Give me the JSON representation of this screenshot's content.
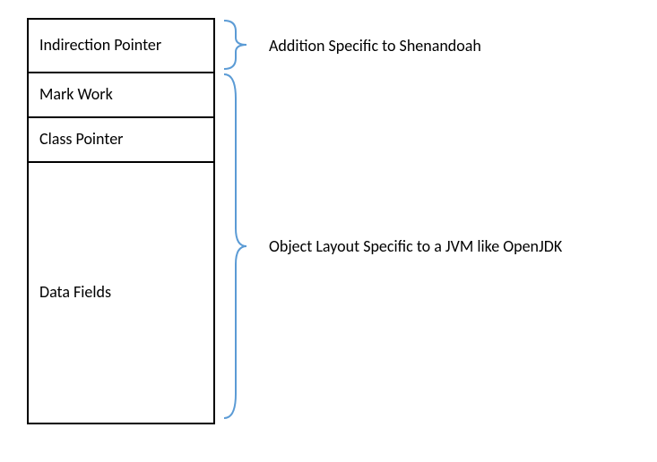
{
  "cells": {
    "indirection": "Indirection Pointer",
    "mark": "Mark Work",
    "classp": "Class Pointer",
    "data": "Data Fields"
  },
  "labels": {
    "top": "Addition Specific to Shenandoah",
    "bottom": "Object Layout Specific to a JVM like OpenJDK"
  }
}
